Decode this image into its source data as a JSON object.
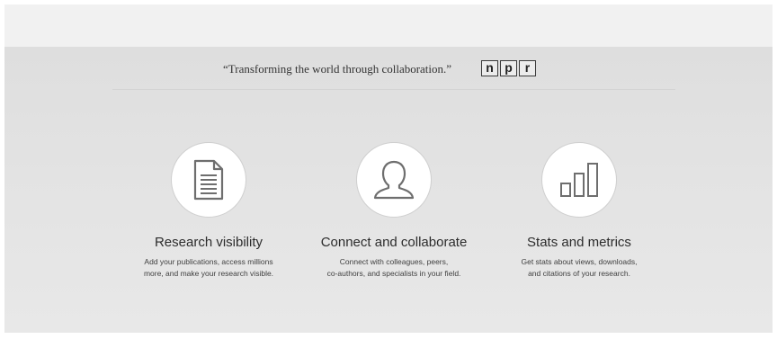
{
  "quote": {
    "text": "“Transforming the world through collaboration.”",
    "logo_letters": [
      "n",
      "p",
      "r"
    ]
  },
  "features": [
    {
      "icon": "document-icon",
      "title": "Research visibility",
      "desc_lines": [
        "Add your publications, access millions",
        "more, and make your research visible."
      ]
    },
    {
      "icon": "person-icon",
      "title": "Connect and collaborate",
      "desc_lines": [
        "Connect with colleagues, peers,",
        "co-authors, and specialists in your field."
      ]
    },
    {
      "icon": "bar-chart-icon",
      "title": "Stats and metrics",
      "desc_lines": [
        "Get stats about views, downloads,",
        "and citations of your research."
      ]
    }
  ],
  "colors": {
    "panel": "#e3e3e3",
    "icon_stroke": "#6e6e6e"
  }
}
